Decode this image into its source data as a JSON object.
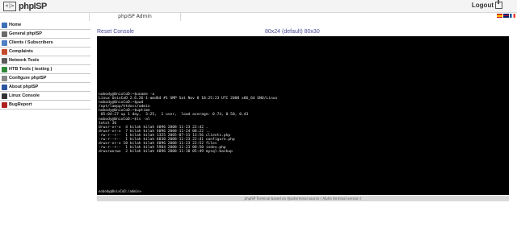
{
  "header": {
    "logo_box": "<|>",
    "logo_text": "phpISP",
    "logout_label": "Logout",
    "tab_label": "phpISP Admin",
    "flags": [
      {
        "name": "flag-es",
        "color_top": "#c60b1e",
        "color_mid": "#ffc400"
      },
      {
        "name": "flag-uk",
        "color_top": "#012169",
        "color_mid": "#c8102e"
      },
      {
        "name": "flag-fr",
        "color_top": "#0055a4",
        "color_mid": "#ef4135"
      }
    ]
  },
  "sidebar": {
    "items": [
      {
        "label": "Home",
        "icon": "home-icon",
        "color": "#3b6fb6"
      },
      {
        "label": "General phpISP",
        "icon": "general-icon",
        "color": "#6a6a6a"
      },
      {
        "label": "Clients / Subscribers",
        "icon": "clients-icon",
        "color": "#4f7fc4"
      },
      {
        "label": "Complaints",
        "icon": "complaints-icon",
        "color": "#c24a2a"
      },
      {
        "label": "Network Tools",
        "icon": "network-icon",
        "color": "#5a5a5a"
      },
      {
        "label": "HTB Tools ( testing )",
        "icon": "htb-icon",
        "color": "#2f8a3a"
      },
      {
        "label": "Configure phpISP",
        "icon": "configure-icon",
        "color": "#888888"
      },
      {
        "label": "About phpISP",
        "icon": "about-icon",
        "color": "#2a55a0"
      },
      {
        "label": "Linux Console",
        "icon": "console-icon",
        "color": "#333333"
      },
      {
        "label": "BugReport",
        "icon": "bug-icon",
        "color": "#b02020"
      }
    ]
  },
  "console": {
    "reset_label": "Reset Console",
    "size_label": "80x24 (default) 80x30",
    "lines": [
      "nobody@UnixCoD:~$uname -a",
      "Linux UnixCoD 2.6.26-1-amd64 #1 SMP Sat Nov 8 18:25:23 UTC 2008 x86_64 GNU/Linux",
      "nobody@UnixCoD:~$pwd",
      "/opt/lampp/htdocs/admin",
      "nobody@UnixCoD:~$uptime",
      " 05:04:27 up 1 day,  3:25,  1 user,  load average: 0.74, 0.50, 0.43",
      "nobody@UnixCoD:~$ls -al",
      "total 36",
      "drwxr-xr-x  4 kilah kilah 4096 2008-11-23 22:42 .",
      "drwxr-xr-x  7 kilah kilah 4096 2008-11-24 00:22 ..",
      "-rw-r--r--  1 kilah kilah 1325 2005-07-31 13:56 clients.php",
      "-rw-r--r--  1 kilah kilah 6830 2008-11-23 22:41 configure.php",
      "drwxr-xr-x 10 kilah kilah 4096 2008-11-23 22:52 files",
      "-rw-r--r--  1 kilah kilah 5984 2008-11-23 08:50 index.php",
      "drwxrwxrwx  2 kilah kilah 4096 2008-11-10 05:49 mysql-backup"
    ],
    "prompt": "nobody@UnixCoD:/admin>",
    "footer": "phpISP Terminal based on Ajaxterminal source ( Alpha terminal version )"
  }
}
